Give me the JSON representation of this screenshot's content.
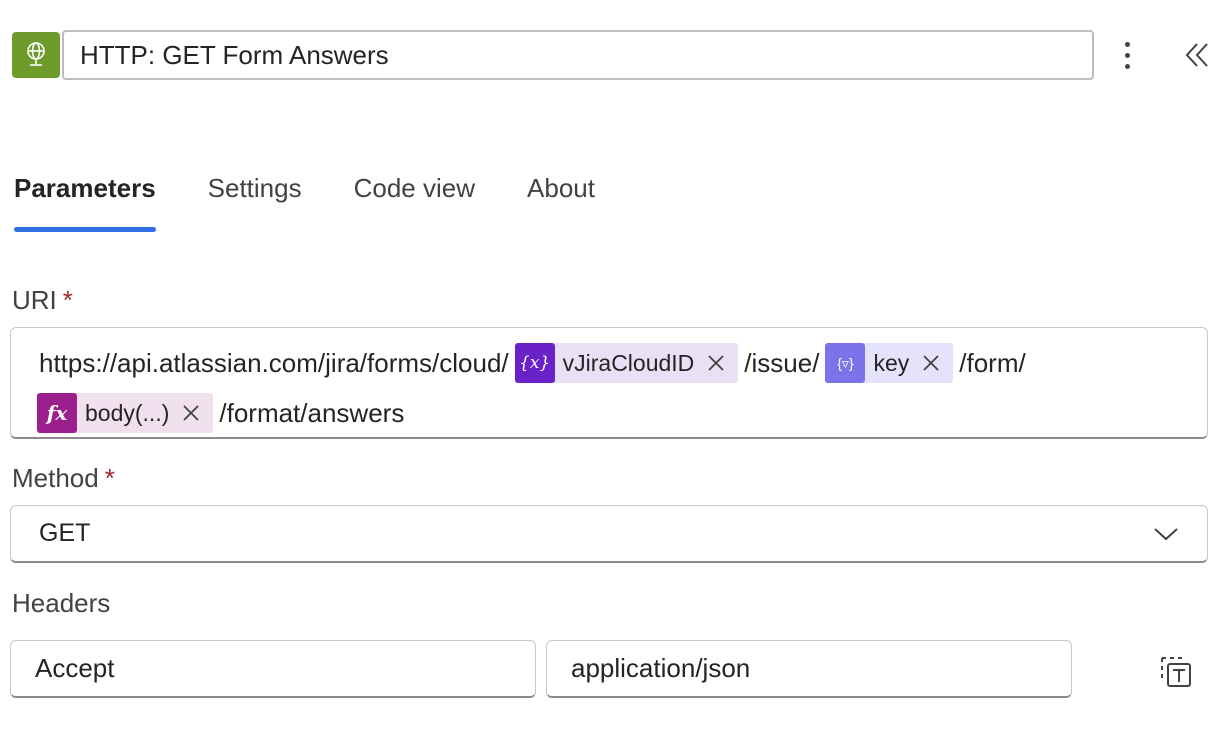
{
  "header": {
    "title_value": "HTTP: GET Form Answers",
    "app_icon": "globe-icon",
    "more_icon": "more-vertical-icon",
    "collapse_icon": "chevron-double-left-icon"
  },
  "tabs": [
    {
      "label": "Parameters",
      "active": true
    },
    {
      "label": "Settings",
      "active": false
    },
    {
      "label": "Code view",
      "active": false
    },
    {
      "label": "About",
      "active": false
    }
  ],
  "uri": {
    "label": "URI",
    "required_mark": "*",
    "segments": {
      "base": "https://api.atlassian.com/jira/forms/cloud/",
      "token1": {
        "type": "variable",
        "icon": "{x}",
        "label": "vJiraCloudID"
      },
      "path1": "/issue/",
      "token2": {
        "type": "output",
        "icon": "{▿}",
        "label": "key"
      },
      "path2": "/form/",
      "token3": {
        "type": "expression",
        "icon": "fx",
        "label": "body(...)"
      },
      "path3": "/format/answers"
    }
  },
  "method": {
    "label": "Method",
    "required_mark": "*",
    "selected": "GET"
  },
  "headers": {
    "label": "Headers",
    "rows": [
      {
        "key": "Accept",
        "value": "application/json"
      }
    ]
  },
  "colors": {
    "accent": "#2f6fe3",
    "app_icon_bg": "#6f9a2c",
    "variable_token": "#6b21c8",
    "output_token": "#7b73ea",
    "expression_token": "#9b1f8d",
    "required": "#a4262c"
  }
}
